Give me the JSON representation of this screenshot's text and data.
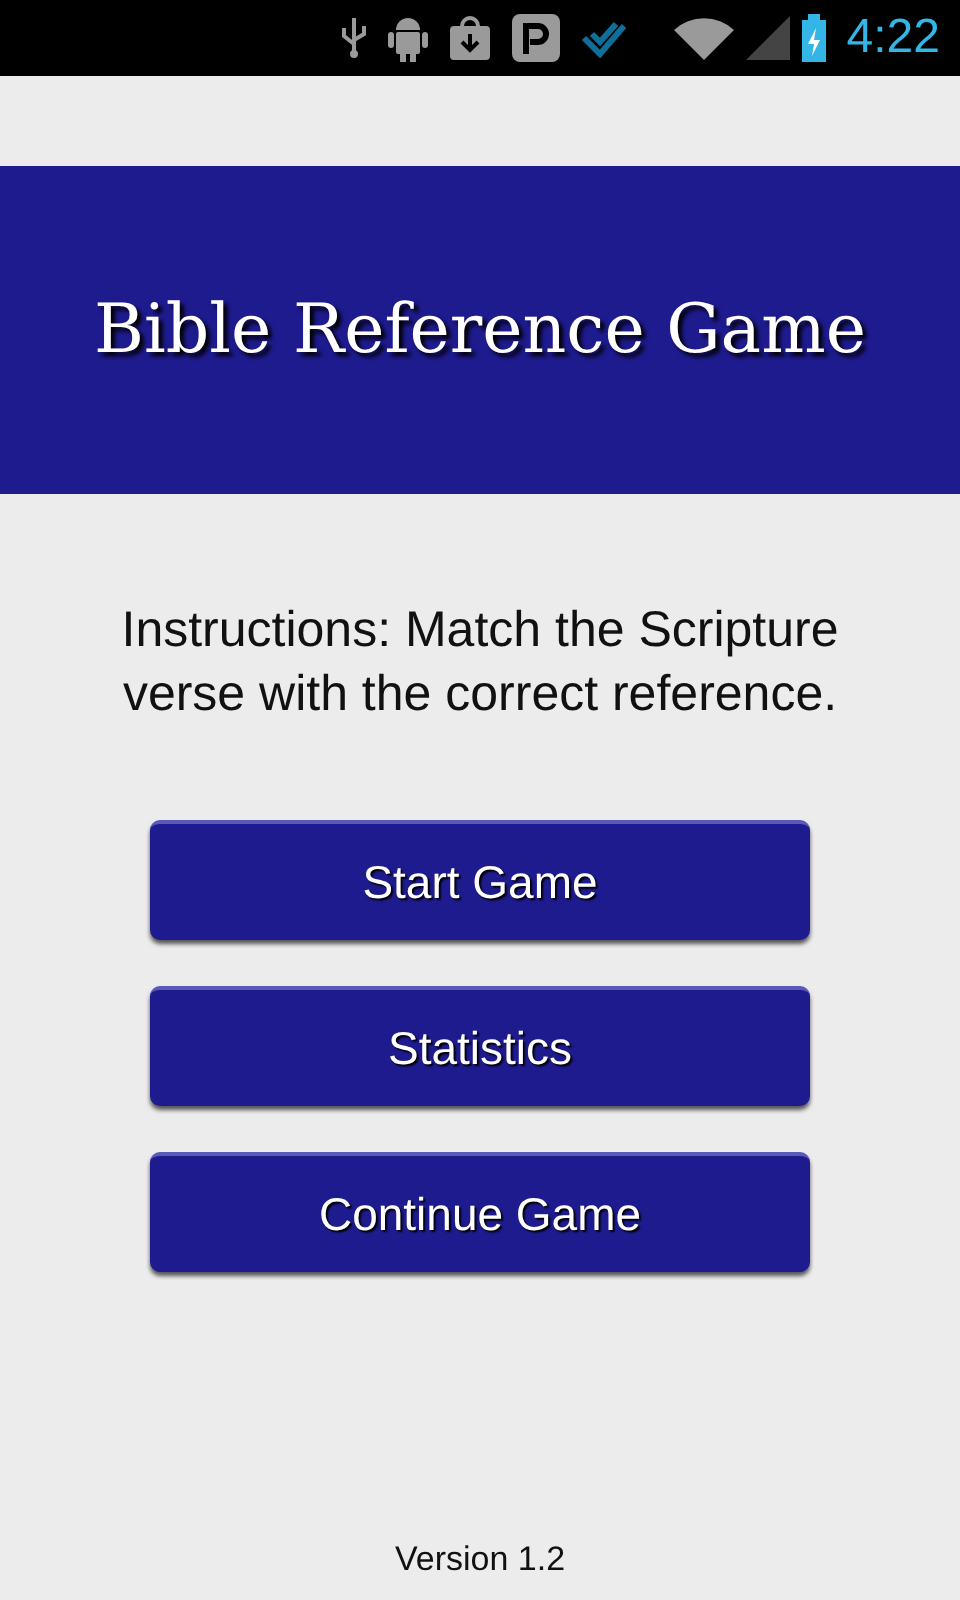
{
  "status_bar": {
    "time": "4:22"
  },
  "title": "Bible Reference Game",
  "instructions": "Instructions: Match the Scripture verse with the correct reference.",
  "buttons": [
    {
      "label": "Start Game"
    },
    {
      "label": "Statistics"
    },
    {
      "label": "Continue Game"
    }
  ],
  "version": "Version 1.2"
}
